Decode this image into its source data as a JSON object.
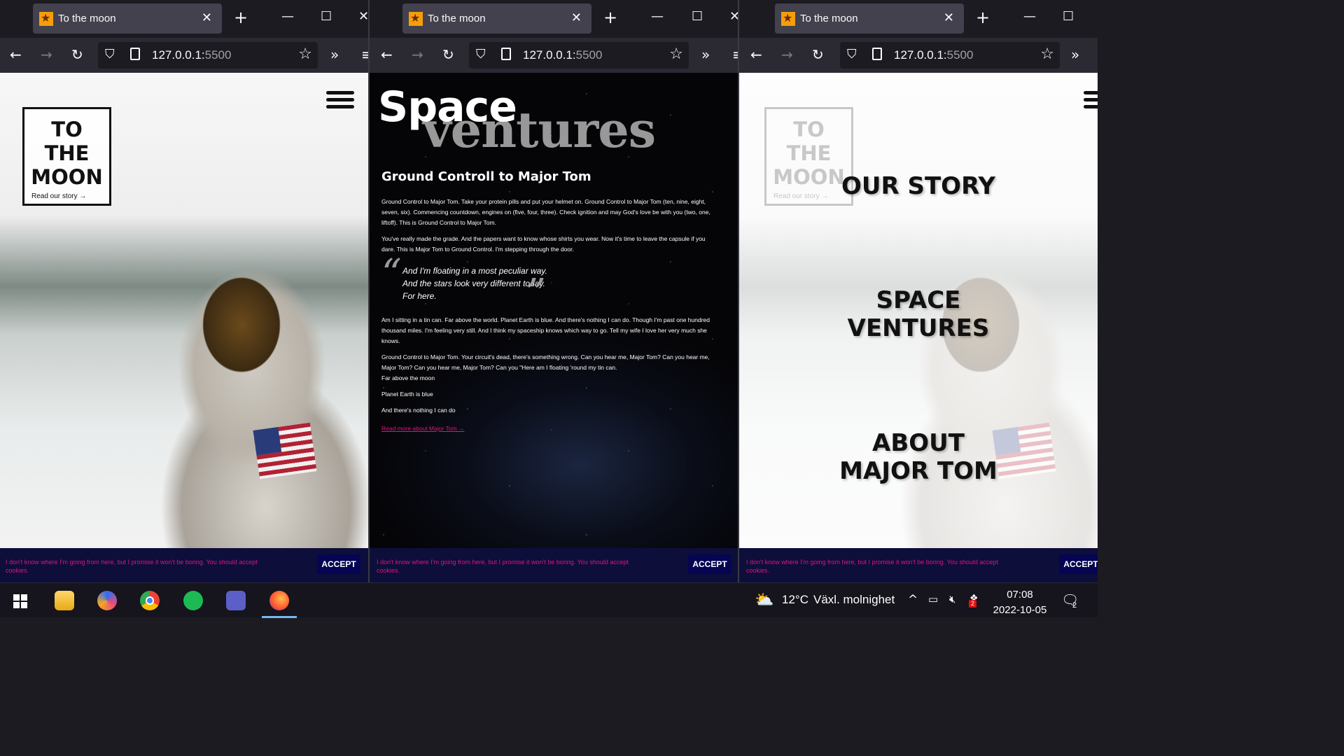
{
  "browser": {
    "tab_title": "To the moon",
    "url_host": "127.0.0.1:",
    "url_port": "5500"
  },
  "page": {
    "logo_line1": "TO",
    "logo_line2": "THE",
    "logo_line3": "MOON",
    "logo_link": "Read our story →"
  },
  "article": {
    "heading_space": "Space",
    "heading_ventures": "ventures",
    "title": "Ground Controll to Major Tom",
    "p1": "Ground Control to Major Tom. Take your protein pills and put your helmet on. Ground Control to Major Tom (ten, nine, eight, seven, six). Commencing countdown, engines on (five, four, three). Check ignition and may God's love be with you (two, one, liftoff). This is Ground Control to Major Tom.",
    "p2": "You've really made the grade. And the papers want to know whose shirts you wear. Now it's time to leave the capsule if you dare. This is Major Tom to Ground Control. I'm stepping through the door.",
    "quote_l1": "And I'm floating in a most peculiar way.",
    "quote_l2": "And the stars look very different today.",
    "quote_l3": "For here.",
    "p3": "Am I sitting in a tin can. Far above the world. Planet Earth is blue. And there's nothing I can do. Though I'm past one hundred thousand miles. I'm feeling very still. And I think my spaceship knows which way to go. Tell my wife I love her very much she knows.",
    "p4a": "Ground Control to Major Tom. Your circuit's dead, there's something wrong. Can you hear me, Major Tom? Can you hear me, Major Tom? Can you hear me, Major Tom? Can you \"Here am I floating 'round my tin can.",
    "p4b": "Far above the moon",
    "p5": "Planet Earth is blue",
    "p6": "And there's nothing I can do",
    "link": "Read more about Major Tom →"
  },
  "menu": {
    "item1": "OUR STORY",
    "item2_l1": "SPACE",
    "item2_l2": "VENTURES",
    "item3_l1": "ABOUT",
    "item3_l2": "MAJOR TOM"
  },
  "cookie": {
    "text": "I don't know where I'm going from here, but I promise it won't be boring. You should accept cookies.",
    "accept": "ACCEPT"
  },
  "taskbar": {
    "temperature": "12°C",
    "weather": "Växl. molnighet",
    "time": "07:08",
    "date": "2022-10-05",
    "notification_count": "2",
    "tray_badge": "2"
  },
  "colors": {
    "accent_pink": "#e0147e",
    "cookie_bg": "#0d0e3a",
    "accept_bg": "#050553",
    "browser_tab": "#42414d"
  }
}
